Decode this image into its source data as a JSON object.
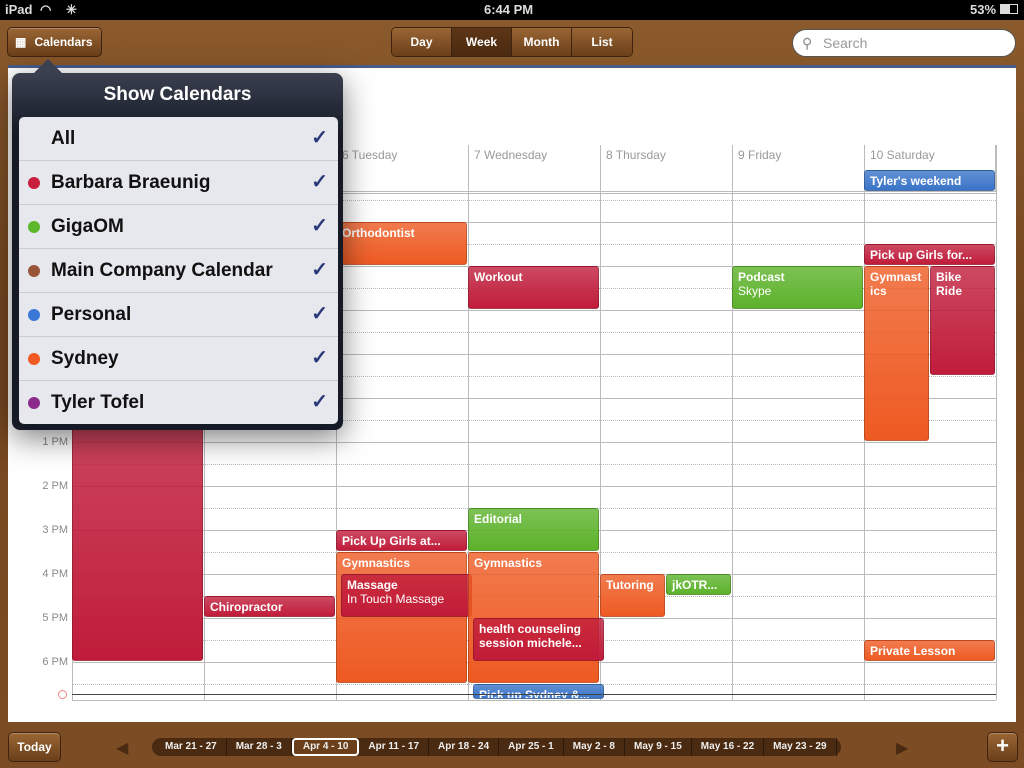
{
  "status": {
    "device": "iPad",
    "time": "6:44 PM",
    "battery": "53%"
  },
  "toolbar": {
    "calendars_label": "Calendars",
    "views": [
      "Day",
      "Week",
      "Month",
      "List"
    ],
    "active_view": "Week",
    "search_placeholder": "Search"
  },
  "week": {
    "days": [
      "6 Tuesday",
      "7 Wednesday",
      "8 Thursday",
      "9 Friday",
      "10 Saturday"
    ],
    "time_labels": [
      "1 PM",
      "2 PM",
      "3 PM",
      "4 PM",
      "5 PM",
      "6 PM"
    ]
  },
  "events": [
    {
      "title": "",
      "day": 0,
      "start": "12:00",
      "end": "18:00",
      "calendar": "Barbara Braeunig"
    },
    {
      "title": "Chiropractor",
      "day": 1,
      "start": "16:30",
      "end": "17:00",
      "calendar": "Barbara Braeunig"
    },
    {
      "title": "Orthodontist",
      "day": 2,
      "start": "08:00",
      "end": "09:00",
      "calendar": "Sydney"
    },
    {
      "title": "Pick Up Girls at...",
      "day": 2,
      "start": "15:00",
      "end": "15:30",
      "calendar": "Barbara Braeunig"
    },
    {
      "title": "Gymnastics",
      "day": 2,
      "start": "15:30",
      "end": "18:30",
      "calendar": "Sydney"
    },
    {
      "title": "Massage",
      "subtitle": "In Touch Massage",
      "day": 2,
      "start": "16:00",
      "end": "17:00",
      "calendar": "Barbara Braeunig",
      "indent": true
    },
    {
      "title": "Workout",
      "day": 3,
      "start": "09:00",
      "end": "10:00",
      "calendar": "Barbara Braeunig"
    },
    {
      "title": "Editorial",
      "day": 3,
      "start": "14:30",
      "end": "15:30",
      "calendar": "GigaOM"
    },
    {
      "title": "Gymnastics",
      "day": 3,
      "start": "15:30",
      "end": "18:30",
      "calendar": "Sydney"
    },
    {
      "title": "health counseling session michele...",
      "day": 3,
      "start": "17:00",
      "end": "18:00",
      "calendar": "Barbara Braeunig",
      "indent": true
    },
    {
      "title": "Pick up Sydney &...",
      "day": 3,
      "start": "18:30",
      "end": "19:00",
      "calendar": "Personal",
      "indent": true
    },
    {
      "title": "Tutoring",
      "day": 4,
      "start": "16:00",
      "end": "17:00",
      "calendar": "Sydney",
      "half": "left"
    },
    {
      "title": "jkOTR...",
      "day": 4,
      "start": "16:00",
      "end": "16:30",
      "calendar": "GigaOM",
      "half": "right"
    },
    {
      "title": "Podcast",
      "subtitle": "Skype",
      "day": 5,
      "start": "09:00",
      "end": "10:00",
      "calendar": "GigaOM"
    },
    {
      "title": "Pick up Girls for...",
      "day": 6,
      "start": "08:30",
      "end": "09:00",
      "calendar": "Barbara Braeunig"
    },
    {
      "title": "Gymnast ics",
      "day": 6,
      "start": "09:00",
      "end": "13:00",
      "calendar": "Sydney",
      "half": "left"
    },
    {
      "title": "Bike Ride",
      "day": 6,
      "start": "09:00",
      "end": "11:30",
      "calendar": "Barbara Braeunig",
      "half": "right"
    },
    {
      "title": "Private Lesson",
      "day": 6,
      "start": "17:30",
      "end": "18:00",
      "calendar": "Sydney"
    }
  ],
  "all_day": [
    {
      "title": "Tyler's weekend",
      "day": 6,
      "calendar": "Personal"
    }
  ],
  "popover": {
    "title": "Show Calendars",
    "items": [
      {
        "label": "All",
        "color": null,
        "checked": true
      },
      {
        "label": "Barbara Braeunig",
        "color": "#c8203c",
        "checked": true
      },
      {
        "label": "GigaOM",
        "color": "#5cb82a",
        "checked": true
      },
      {
        "label": "Main Company Calendar",
        "color": "#9a5538",
        "checked": true
      },
      {
        "label": "Personal",
        "color": "#3a78d8",
        "checked": true
      },
      {
        "label": "Sydney",
        "color": "#f05a22",
        "checked": true
      },
      {
        "label": "Tyler Tofel",
        "color": "#8a2a8a",
        "checked": true
      }
    ]
  },
  "calendar_colors": {
    "Barbara Braeunig": "#c01c3a",
    "GigaOM": "#5cb22a",
    "Personal": "#3a74c8",
    "Sydney": "#ee5a22"
  },
  "bottom": {
    "today_label": "Today",
    "weeks": [
      "Mar 21 - 27",
      "Mar 28 - 3",
      "Apr 4 - 10",
      "Apr 11 - 17",
      "Apr 18 - 24",
      "Apr 25 - 1",
      "May 2 - 8",
      "May 9 - 15",
      "May 16 - 22",
      "May 23 - 29"
    ],
    "active_week": "Apr 4 - 10",
    "add_label": "+"
  },
  "current_time": "18:44"
}
